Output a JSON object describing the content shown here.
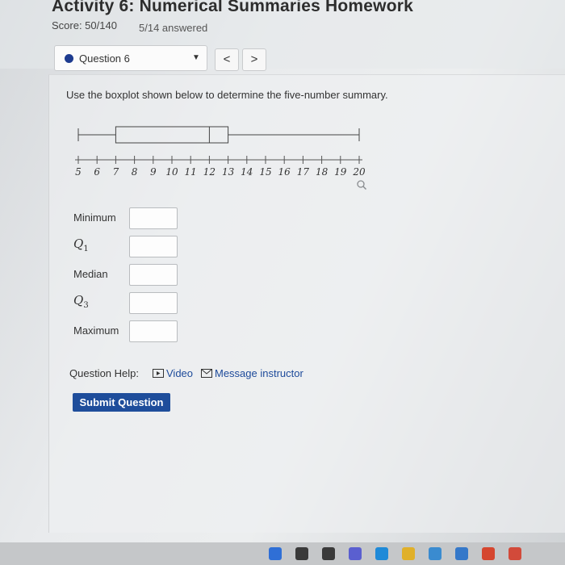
{
  "header": {
    "title": "Activity 6: Numerical Summaries Homework",
    "score": "Score: 50/140",
    "answered": "5/14 answered"
  },
  "question_nav": {
    "label": "Question 6",
    "prev": "<",
    "next": ">"
  },
  "prompt": "Use the boxplot shown below to determine the five-number summary.",
  "chart_data": {
    "type": "boxplot",
    "orientation": "horizontal",
    "x_ticks": [
      5,
      6,
      7,
      8,
      9,
      10,
      11,
      12,
      13,
      14,
      15,
      16,
      17,
      18,
      19,
      20
    ],
    "xlim": [
      5,
      20
    ],
    "five_number_summary": {
      "min": 5,
      "q1": 7,
      "median": 12,
      "q3": 13,
      "max": 20
    }
  },
  "fields": [
    {
      "label": "Minimum",
      "type": "text"
    },
    {
      "label": "Q",
      "sub": "1",
      "type": "math"
    },
    {
      "label": "Median",
      "type": "text"
    },
    {
      "label": "Q",
      "sub": "3",
      "type": "math"
    },
    {
      "label": "Maximum",
      "type": "text"
    }
  ],
  "help": {
    "label": "Question Help:",
    "video": "Video",
    "message": "Message instructor"
  },
  "submit_label": "Submit Question",
  "colors": {
    "accent": "#1e4d9b",
    "nav_dot": "#1d3b8f"
  },
  "taskbar_icons": [
    "windows-icon",
    "search-icon",
    "file-explorer-icon",
    "chat-icon",
    "edge-icon",
    "folder-icon",
    "store-icon",
    "mail-icon",
    "office-icon",
    "chrome-icon"
  ]
}
